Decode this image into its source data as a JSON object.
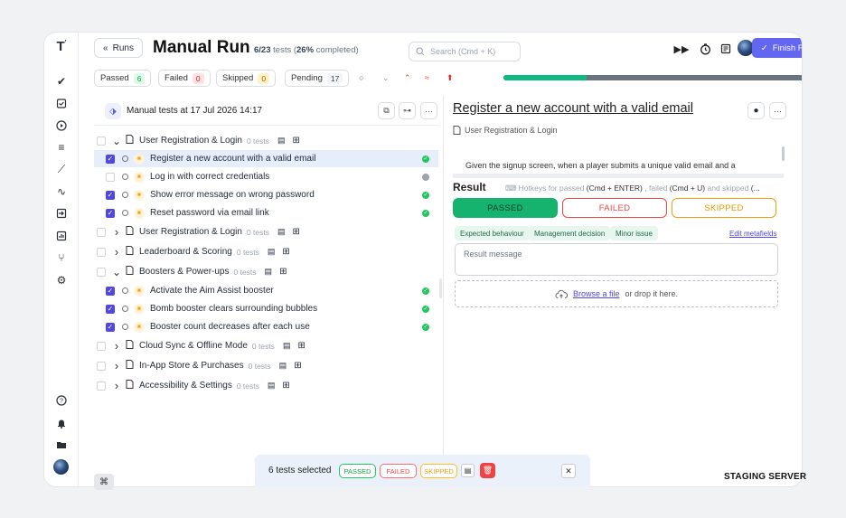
{
  "header": {
    "runs_btn": "Runs",
    "title": "Manual Run",
    "tests_count": "6/23",
    "tests_word": "tests (",
    "completed_pct": "26%",
    "completed_word": "completed)",
    "search_placeholder": "Search (Cmd + K)",
    "finish_label": "Finish Run"
  },
  "status_chips": [
    {
      "label": "Passed",
      "count": "6",
      "color": "#16a34a",
      "bg": "#dcfce7"
    },
    {
      "label": "Failed",
      "count": "0",
      "color": "#dc2626",
      "bg": "#fee2e2"
    },
    {
      "label": "Skipped",
      "count": "0",
      "color": "#b45309",
      "bg": "#fef3c7"
    },
    {
      "label": "Pending",
      "count": "17",
      "color": "#374151",
      "bg": "#f3f4f6"
    }
  ],
  "progress": {
    "passed_fraction": 0.26
  },
  "left_pane": {
    "title": "Manual tests at 17 Jul 2026 14:17",
    "rows": [
      {
        "kind": "suite",
        "expanded": true,
        "label": "User Registration & Login",
        "meta": "0 tests"
      },
      {
        "kind": "test",
        "checked": true,
        "selected": true,
        "label": "Register a new account with a valid email",
        "status": "passed"
      },
      {
        "kind": "test",
        "checked": false,
        "label": "Log in with correct credentials",
        "status": "untested"
      },
      {
        "kind": "test",
        "checked": true,
        "label": "Show error message on wrong password",
        "status": "passed"
      },
      {
        "kind": "test",
        "checked": true,
        "label": "Reset password via email link",
        "status": "passed"
      },
      {
        "kind": "suite",
        "expanded": false,
        "label": "User Registration & Login",
        "meta": "0 tests"
      },
      {
        "kind": "suite",
        "expanded": false,
        "label": "Leaderboard & Scoring",
        "meta": "0 tests"
      },
      {
        "kind": "suite",
        "expanded": true,
        "label": "Boosters & Power-ups",
        "meta": "0 tests"
      },
      {
        "kind": "test",
        "checked": true,
        "label": "Activate the Aim Assist booster",
        "status": "passed"
      },
      {
        "kind": "test",
        "checked": true,
        "label": "Bomb booster clears surrounding bubbles",
        "status": "passed"
      },
      {
        "kind": "test",
        "checked": true,
        "label": "Booster count decreases after each use",
        "status": "passed"
      },
      {
        "kind": "suite",
        "expanded": false,
        "label": "Cloud Sync & Offline Mode",
        "meta": "0 tests"
      },
      {
        "kind": "suite",
        "expanded": false,
        "label": "In-App Store & Purchases",
        "meta": "0 tests"
      },
      {
        "kind": "suite",
        "expanded": false,
        "label": "Accessibility & Settings",
        "meta": "0 tests"
      }
    ]
  },
  "detail": {
    "title": "Register a new account with a valid email",
    "suite": "User Registration & Login",
    "description": "Given the signup screen, when a player submits a unique valid email and a",
    "result_label": "Result",
    "hotkeys_prefix": "Hotkeys for passed",
    "hotkeys_passed": "(Cmd + ENTER)",
    "hotkeys_mid": ", failed",
    "hotkeys_failed": "(Cmd + U)",
    "hotkeys_mid2": "and skipped",
    "hotkeys_tail": "(...",
    "passed": "PASSED",
    "failed": "FAILED",
    "skipped": "SKIPPED",
    "tags": [
      "Expected behaviour",
      "Management decision",
      "Minor issue"
    ],
    "edit_metafields": "Edit metafields",
    "message_placeholder": "Result message",
    "browse": "Browse a file",
    "drop_text": "or drop it here."
  },
  "bulk_bar": {
    "text": "6 tests selected",
    "passed": "PASSED",
    "failed": "FAILED",
    "skipped": "SKIPPED"
  },
  "footer": {
    "staging": "STAGING SERVER",
    "cmd_icon": "⌘"
  },
  "colors": {
    "accent": "#6366f1",
    "passed": "#22c55e",
    "failed": "#ef4444",
    "skipped": "#f59e0b"
  }
}
